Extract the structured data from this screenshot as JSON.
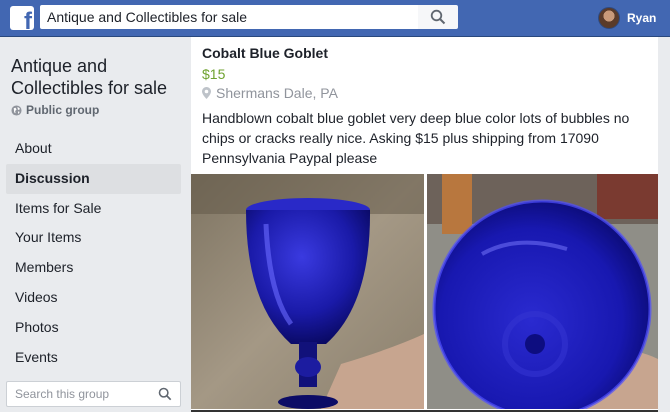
{
  "header": {
    "logo_letter": "f",
    "search_value": "Antique and Collectibles for sale",
    "user_name": "Ryan"
  },
  "sidebar": {
    "group_name": "Antique and Collectibles for sale",
    "group_type": "Public group",
    "items": [
      {
        "label": "About"
      },
      {
        "label": "Discussion"
      },
      {
        "label": "Items for Sale"
      },
      {
        "label": "Your Items"
      },
      {
        "label": "Members"
      },
      {
        "label": "Videos"
      },
      {
        "label": "Photos"
      },
      {
        "label": "Events"
      }
    ],
    "active_item": "Discussion",
    "search_placeholder": "Search this group"
  },
  "post": {
    "title": "Cobalt Blue Goblet",
    "price": "$15",
    "location": "Shermans Dale, PA",
    "description": "Handblown cobalt blue goblet very deep blue color lots of bubbles no chips or cracks really nice. Asking $15 plus shipping from 17090 Pennsylvania Paypal please"
  },
  "colors": {
    "brand_blue": "#4267b2",
    "price_green": "#6fa22f",
    "cobalt": "#1a1aa8"
  }
}
